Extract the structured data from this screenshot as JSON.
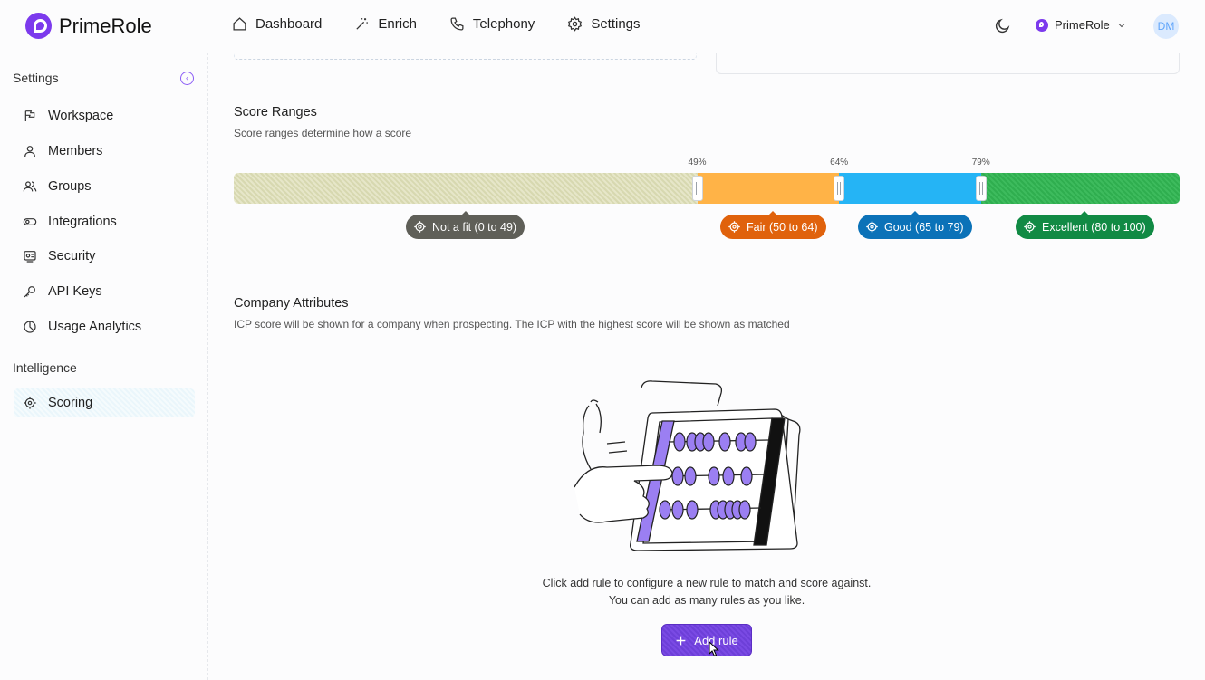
{
  "app": {
    "name": "PrimeRole"
  },
  "nav": [
    {
      "label": "Dashboard",
      "icon": "home-icon"
    },
    {
      "label": "Enrich",
      "icon": "wand-icon"
    },
    {
      "label": "Telephony",
      "icon": "phone-icon"
    },
    {
      "label": "Settings",
      "icon": "gear-icon"
    }
  ],
  "header": {
    "org_name": "PrimeRole",
    "avatar_initials": "DM"
  },
  "sidebar": {
    "settings_heading": "Settings",
    "items": [
      {
        "label": "Workspace",
        "icon": "flag-icon"
      },
      {
        "label": "Members",
        "icon": "user-icon"
      },
      {
        "label": "Groups",
        "icon": "users-icon"
      },
      {
        "label": "Integrations",
        "icon": "toggle-icon"
      },
      {
        "label": "Security",
        "icon": "shield-icon"
      },
      {
        "label": "API Keys",
        "icon": "key-icon"
      },
      {
        "label": "Usage Analytics",
        "icon": "pie-chart-icon"
      }
    ],
    "intelligence_heading": "Intelligence",
    "intelligence_items": [
      {
        "label": "Scoring",
        "icon": "target-icon",
        "active": true
      }
    ]
  },
  "score_ranges": {
    "title": "Score Ranges",
    "subtitle": "Score ranges determine how a score",
    "thresholds": [
      {
        "label": "49%",
        "value": 49
      },
      {
        "label": "64%",
        "value": 64
      },
      {
        "label": "79%",
        "value": 79
      }
    ],
    "ranges": [
      {
        "label": "Not a fit (0 to 49)",
        "min": 0,
        "max": 49,
        "color": "#5f5f58"
      },
      {
        "label": "Fair (50 to 64)",
        "min": 50,
        "max": 64,
        "color": "#e0620c"
      },
      {
        "label": "Good (65 to 79)",
        "min": 65,
        "max": 79,
        "color": "#0b72b8"
      },
      {
        "label": "Excellent (80 to 100)",
        "min": 80,
        "max": 100,
        "color": "#118a44"
      }
    ]
  },
  "company_attributes": {
    "title": "Company Attributes",
    "subtitle": "ICP score will be shown for a company when prospecting. The ICP with the highest score will be shown as matched",
    "empty_line1": "Click add rule to configure a new rule to match and score against.",
    "empty_line2": "You can add as many rules as you like.",
    "add_button": "Add rule"
  }
}
